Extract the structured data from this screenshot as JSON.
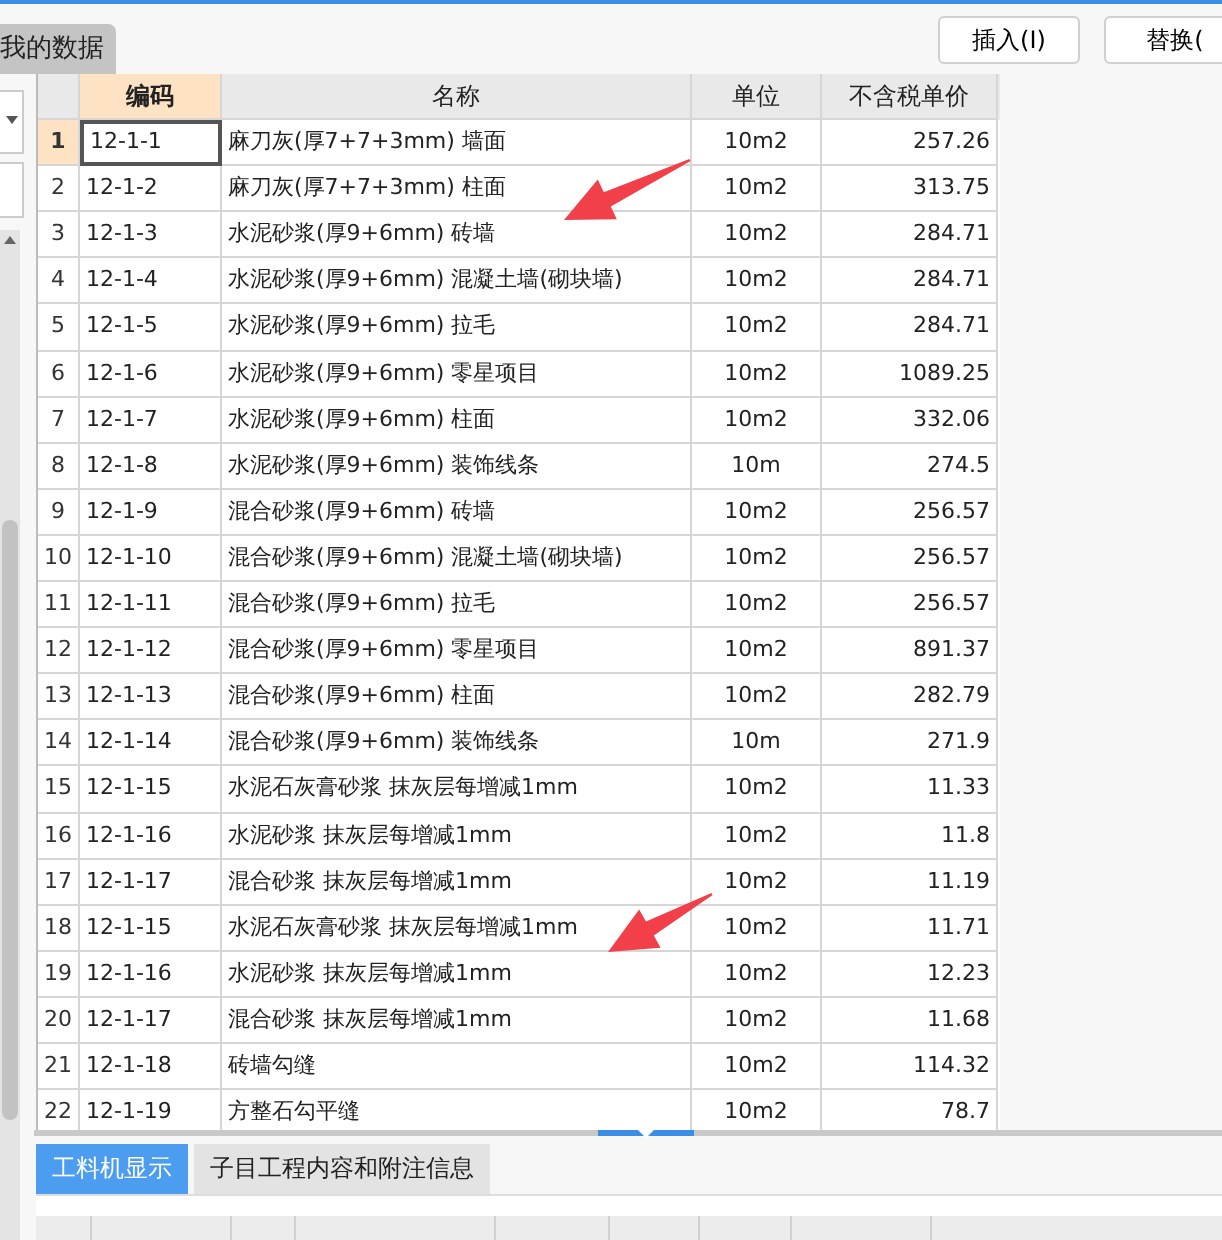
{
  "top_tab": {
    "label": "我的数据",
    "selected": true
  },
  "buttons": [
    "插入(I)",
    "替换("
  ],
  "table": {
    "columns": [
      {
        "label": "编码",
        "selected": true
      },
      {
        "label": "名称",
        "selected": false
      },
      {
        "label": "单位",
        "selected": false
      },
      {
        "label": "不含税单价",
        "selected": false
      }
    ],
    "rows": [
      {
        "index": "1",
        "code": "12-1-1",
        "name": "麻刀灰(厚7+7+3mm) 墙面",
        "unit": "10m2",
        "price": "257.26",
        "selected": true
      },
      {
        "index": "2",
        "code": "12-1-2",
        "name": "麻刀灰(厚7+7+3mm) 柱面",
        "unit": "10m2",
        "price": "313.75",
        "selected": false
      },
      {
        "index": "3",
        "code": "12-1-3",
        "name": "水泥砂浆(厚9+6mm) 砖墙",
        "unit": "10m2",
        "price": "284.71",
        "selected": false
      },
      {
        "index": "4",
        "code": "12-1-4",
        "name": "水泥砂浆(厚9+6mm) 混凝土墙(砌块墙)",
        "unit": "10m2",
        "price": "284.71",
        "selected": false
      },
      {
        "index": "5",
        "code": "12-1-5",
        "name": "水泥砂浆(厚9+6mm) 拉毛",
        "unit": "10m2",
        "price": "284.71",
        "selected": false
      },
      {
        "index": "6",
        "code": "12-1-6",
        "name": "水泥砂浆(厚9+6mm) 零星项目",
        "unit": "10m2",
        "price": "1089.25",
        "selected": false
      },
      {
        "index": "7",
        "code": "12-1-7",
        "name": "水泥砂浆(厚9+6mm) 柱面",
        "unit": "10m2",
        "price": "332.06",
        "selected": false
      },
      {
        "index": "8",
        "code": "12-1-8",
        "name": "水泥砂浆(厚9+6mm) 装饰线条",
        "unit": "10m",
        "price": "274.5",
        "selected": false
      },
      {
        "index": "9",
        "code": "12-1-9",
        "name": "混合砂浆(厚9+6mm) 砖墙",
        "unit": "10m2",
        "price": "256.57",
        "selected": false
      },
      {
        "index": "10",
        "code": "12-1-10",
        "name": "混合砂浆(厚9+6mm) 混凝土墙(砌块墙)",
        "unit": "10m2",
        "price": "256.57",
        "selected": false
      },
      {
        "index": "11",
        "code": "12-1-11",
        "name": "混合砂浆(厚9+6mm) 拉毛",
        "unit": "10m2",
        "price": "256.57",
        "selected": false
      },
      {
        "index": "12",
        "code": "12-1-12",
        "name": "混合砂浆(厚9+6mm) 零星项目",
        "unit": "10m2",
        "price": "891.37",
        "selected": false
      },
      {
        "index": "13",
        "code": "12-1-13",
        "name": "混合砂浆(厚9+6mm) 柱面",
        "unit": "10m2",
        "price": "282.79",
        "selected": false
      },
      {
        "index": "14",
        "code": "12-1-14",
        "name": "混合砂浆(厚9+6mm) 装饰线条",
        "unit": "10m",
        "price": "271.9",
        "selected": false
      },
      {
        "index": "15",
        "code": "12-1-15",
        "name": "水泥石灰膏砂浆 抹灰层每增减1mm",
        "unit": "10m2",
        "price": "11.33",
        "selected": false
      },
      {
        "index": "16",
        "code": "12-1-16",
        "name": "水泥砂浆 抹灰层每增减1mm",
        "unit": "10m2",
        "price": "11.8",
        "selected": false
      },
      {
        "index": "17",
        "code": "12-1-17",
        "name": "混合砂浆 抹灰层每增减1mm",
        "unit": "10m2",
        "price": "11.19",
        "selected": false
      },
      {
        "index": "18",
        "code": "12-1-15",
        "name": "水泥石灰膏砂浆 抹灰层每增减1mm",
        "unit": "10m2",
        "price": "11.71",
        "selected": false
      },
      {
        "index": "19",
        "code": "12-1-16",
        "name": "水泥砂浆 抹灰层每增减1mm",
        "unit": "10m2",
        "price": "12.23",
        "selected": false
      },
      {
        "index": "20",
        "code": "12-1-17",
        "name": "混合砂浆 抹灰层每增减1mm",
        "unit": "10m2",
        "price": "11.68",
        "selected": false
      },
      {
        "index": "21",
        "code": "12-1-18",
        "name": "砖墙勾缝",
        "unit": "10m2",
        "price": "114.32",
        "selected": false
      },
      {
        "index": "22",
        "code": "12-1-19",
        "name": "方整石勾平缝",
        "unit": "10m2",
        "price": "78.7",
        "selected": false
      }
    ]
  },
  "bottom_tabs": [
    {
      "label": "工料机显示",
      "selected": true
    },
    {
      "label": "子目工程内容和附注信息",
      "selected": false
    }
  ]
}
